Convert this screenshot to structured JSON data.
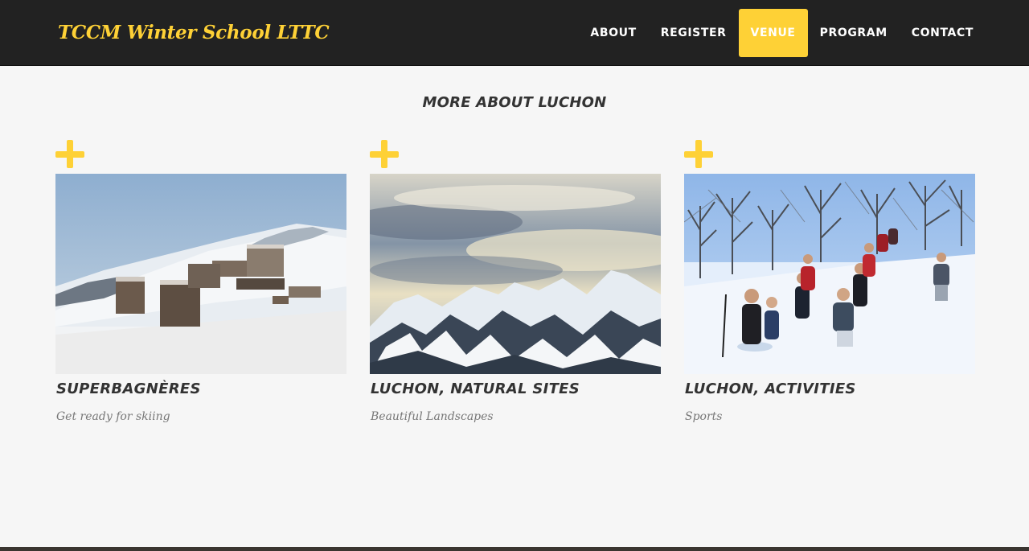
{
  "brand": {
    "title": "TCCM Winter School LTTC"
  },
  "nav": {
    "items": [
      {
        "label": "ABOUT"
      },
      {
        "label": "REGISTER"
      },
      {
        "label": "VENUE",
        "active": true
      },
      {
        "label": "PROGRAM"
      },
      {
        "label": "CONTACT"
      }
    ]
  },
  "section": {
    "title": "MORE ABOUT LUCHON"
  },
  "cards": [
    {
      "title": "SUPERBAGNÈRES",
      "subtitle": "Get ready for skiing"
    },
    {
      "title": "LUCHON, NATURAL SITES",
      "subtitle": "Beautiful Landscapes"
    },
    {
      "title": "LUCHON, ACTIVITIES",
      "subtitle": "Sports"
    }
  ],
  "colors": {
    "accent": "#fed136",
    "navbar": "#222222",
    "background": "#f6f6f6",
    "heading": "#333333",
    "muted": "#777777"
  },
  "icons": {
    "card_expand": "plus-icon"
  }
}
